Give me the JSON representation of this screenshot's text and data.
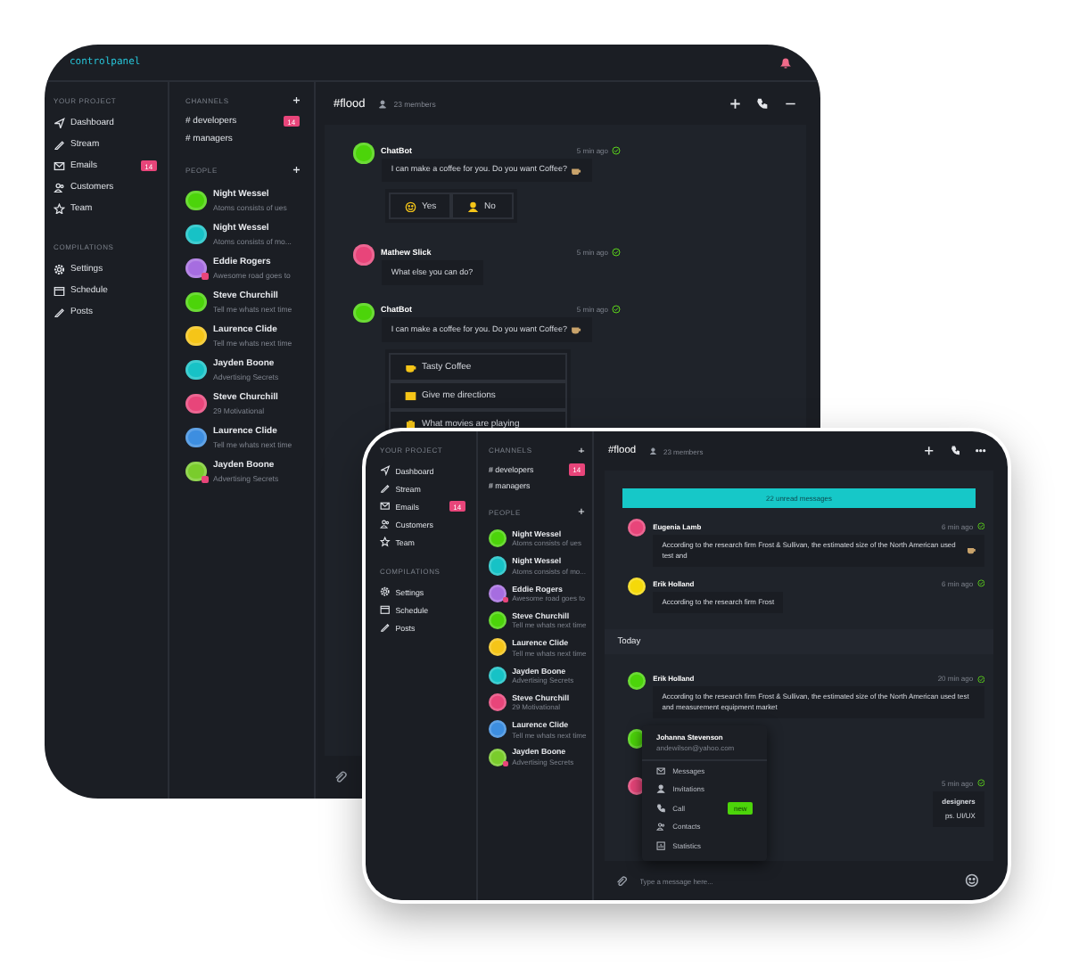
{
  "screens": [
    {
      "kind": "desktop",
      "logo": "controlpanel",
      "sidebar": [
        {
          "heading": "YOUR PROJECT",
          "items": [
            {
              "label": "Dashboard"
            },
            {
              "label": "Stream"
            },
            {
              "label": "Emails",
              "badge": "14"
            },
            {
              "label": "Customers"
            },
            {
              "label": "Team"
            }
          ]
        },
        {
          "heading": "COMPILATIONS",
          "items": [
            {
              "label": "Settings"
            },
            {
              "label": "Schedule"
            },
            {
              "label": "Posts"
            }
          ]
        }
      ],
      "channels": {
        "heading": "CHANNELS",
        "items": [
          {
            "name": "# developers",
            "badge": "14"
          },
          {
            "name": "# managers"
          }
        ]
      },
      "people": {
        "heading": "PEOPLE",
        "items": [
          {
            "name": "Night Wessel",
            "status": "Atoms consists of ues",
            "color": "#4cd40a",
            "alert": false
          },
          {
            "name": "Night Wessel",
            "status": "Atoms consists of mo...",
            "color": "#17c2c6",
            "alert": false
          },
          {
            "name": "Eddie Rogers",
            "status": "Awesome road goes to",
            "color": "#a66de0",
            "alert": true
          },
          {
            "name": "Steve Churchill",
            "status": "Tell me whats next time",
            "color": "#4cd40a",
            "alert": false
          },
          {
            "name": "Laurence Clide",
            "status": "Tell me whats next time",
            "color": "#f5c518",
            "alert": false
          },
          {
            "name": "Jayden Boone",
            "status": "Advertising Secrets",
            "color": "#17c2c6",
            "alert": false
          },
          {
            "name": "Steve Churchill",
            "status": "29 Motivational",
            "color": "#e8457a",
            "alert": false
          },
          {
            "name": "Laurence Clide",
            "status": "Tell me whats next time",
            "color": "#3d8ee0",
            "alert": false
          },
          {
            "name": "Jayden Boone",
            "status": "Advertising Secrets",
            "color": "#7acc2c",
            "alert": true
          }
        ]
      },
      "chat": {
        "title": "#flood",
        "members": "23 members",
        "items": [
          {
            "kind": "message",
            "author": "ChatBot",
            "time": "5 min ago",
            "text": "I can make a coffee for you. Do you want Coffee?",
            "color": "#4cd40a",
            "read": true,
            "emoji": true
          },
          {
            "kind": "choice_row",
            "items": [
              "Yes",
              "No"
            ]
          },
          {
            "kind": "message",
            "author": "Mathew Slick",
            "time": "5 min ago",
            "text": "What else you can do?",
            "color": "#e8457a",
            "read": true,
            "emoji": false
          },
          {
            "kind": "message",
            "author": "ChatBot",
            "time": "5 min ago",
            "text": "I can make a coffee for you. Do you want Coffee?",
            "color": "#4cd40a",
            "read": true,
            "emoji": true
          },
          {
            "kind": "choice_list",
            "items": [
              "Tasty Coffee",
              "Give me directions",
              "What movies are playing"
            ]
          }
        ]
      }
    },
    {
      "kind": "tablet",
      "sidebar": [
        {
          "heading": "YOUR PROJECT",
          "items": [
            {
              "label": "Dashboard"
            },
            {
              "label": "Stream"
            },
            {
              "label": "Emails",
              "badge": "14"
            },
            {
              "label": "Customers"
            },
            {
              "label": "Team"
            }
          ]
        },
        {
          "heading": "COMPILATIONS",
          "items": [
            {
              "label": "Settings"
            },
            {
              "label": "Schedule"
            },
            {
              "label": "Posts"
            }
          ]
        }
      ],
      "channels": {
        "heading": "CHANNELS",
        "items": [
          {
            "name": "# developers",
            "badge": "14"
          },
          {
            "name": "# managers"
          }
        ]
      },
      "people": {
        "heading": "PEOPLE",
        "items": [
          {
            "name": "Night Wessel",
            "status": "Atoms consists of ues",
            "color": "#4cd40a",
            "alert": false
          },
          {
            "name": "Night Wessel",
            "status": "Atoms consists of mo...",
            "color": "#17c2c6",
            "alert": false
          },
          {
            "name": "Eddie Rogers",
            "status": "Awesome road goes to",
            "color": "#a66de0",
            "alert": true
          },
          {
            "name": "Steve Churchill",
            "status": "Tell me whats next time",
            "color": "#4cd40a",
            "alert": false
          },
          {
            "name": "Laurence Clide",
            "status": "Tell me whats next time",
            "color": "#f5c518",
            "alert": false
          },
          {
            "name": "Jayden Boone",
            "status": "Advertising Secrets",
            "color": "#17c2c6",
            "alert": false
          },
          {
            "name": "Steve Churchill",
            "status": "29 Motivational",
            "color": "#e8457a",
            "alert": false
          },
          {
            "name": "Laurence Clide",
            "status": "Tell me whats next time",
            "color": "#3d8ee0",
            "alert": false
          },
          {
            "name": "Jayden Boone",
            "status": "Advertising Secrets",
            "color": "#7acc2c",
            "alert": true
          }
        ]
      },
      "chat": {
        "title": "#flood",
        "members": "23 members",
        "items": [
          {
            "kind": "unread",
            "text": "22 unread messages"
          },
          {
            "kind": "message",
            "author": "Eugenia Lamb",
            "time": "6 min ago",
            "text": "According to the research firm Frost & Sullivan, the estimated size of the North American used test and",
            "color": "#e8457a",
            "read": true,
            "emoji": true
          },
          {
            "kind": "message",
            "author": "Erik Holland",
            "time": "6 min ago",
            "text": "According to the research firm Frost",
            "color": "#f5d90a",
            "read": true,
            "emoji": false
          },
          {
            "kind": "divider",
            "text": "Today"
          },
          {
            "kind": "message",
            "author": "Erik Holland",
            "time": "20 min ago",
            "text": "According to the research firm Frost & Sullivan, the estimated size of the North American used test and measurement equipment market",
            "color": "#4cd40a",
            "read": true,
            "emoji": false
          },
          {
            "kind": "avatar",
            "color": "#4cd40a"
          },
          {
            "kind": "fragment",
            "time": "5 min ago",
            "color": "#e8457a",
            "read": true,
            "lines": [
              "designers",
              "ps. UI/UX"
            ]
          }
        ],
        "popup": {
          "name": "Johanna Stevenson",
          "email": "andewilson@yahoo.com",
          "items": [
            {
              "label": "Messages"
            },
            {
              "label": "Invitations"
            },
            {
              "label": "Call",
              "badge": "new"
            },
            {
              "label": "Contacts"
            },
            {
              "label": "Statistics"
            }
          ]
        },
        "footer": {
          "placeholder": "Type a message here..."
        }
      }
    }
  ]
}
